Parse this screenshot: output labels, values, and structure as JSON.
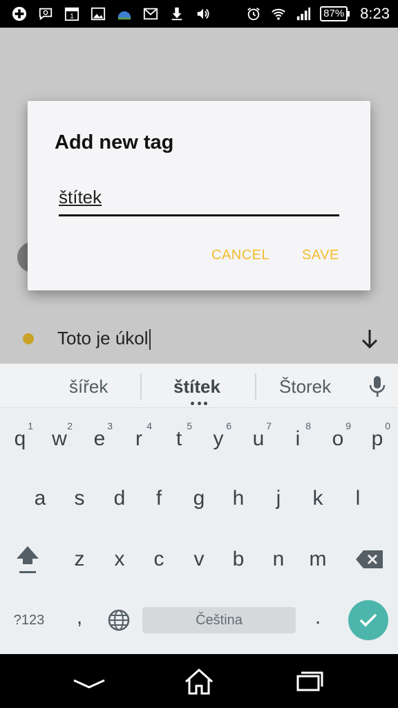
{
  "status_bar": {
    "battery": "87%",
    "time": "8:23"
  },
  "app": {
    "task_text": "Toto je úkol"
  },
  "dialog": {
    "title": "Add new tag",
    "input_value": "štítek",
    "cancel_label": "CANCEL",
    "save_label": "SAVE",
    "accent_color": "#f2bc2b"
  },
  "keyboard": {
    "suggestions": [
      "šířek",
      "štítek",
      "Štorek"
    ],
    "row1": [
      {
        "key": "q",
        "hint": "1"
      },
      {
        "key": "w",
        "hint": "2"
      },
      {
        "key": "e",
        "hint": "3"
      },
      {
        "key": "r",
        "hint": "4"
      },
      {
        "key": "t",
        "hint": "5"
      },
      {
        "key": "y",
        "hint": "6"
      },
      {
        "key": "u",
        "hint": "7"
      },
      {
        "key": "i",
        "hint": "8"
      },
      {
        "key": "o",
        "hint": "9"
      },
      {
        "key": "p",
        "hint": "0"
      }
    ],
    "row2": [
      "a",
      "s",
      "d",
      "f",
      "g",
      "h",
      "j",
      "k",
      "l"
    ],
    "row3": [
      "z",
      "x",
      "c",
      "v",
      "b",
      "n",
      "m"
    ],
    "symbols_label": "?123",
    "comma": ",",
    "space_label": "Čeština",
    "period": ".",
    "enter_color": "#4db6ac"
  }
}
